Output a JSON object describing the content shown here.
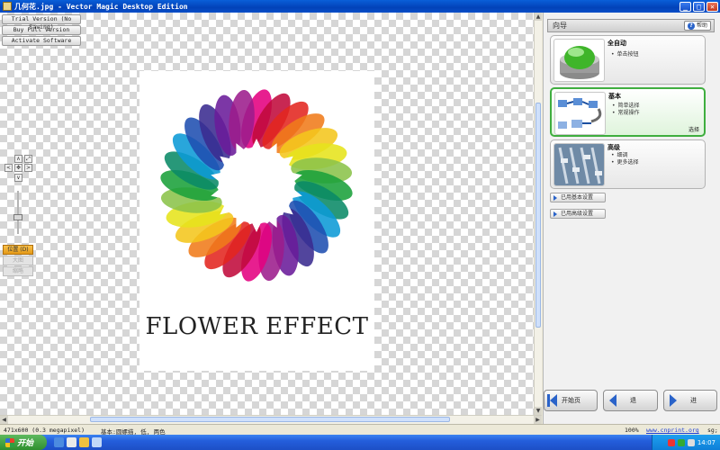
{
  "window": {
    "title": "几何花.jpg - Vector Magic Desktop Edition",
    "buttons": [
      "_",
      "□",
      "✕"
    ]
  },
  "trial": {
    "buttons": [
      "Trial Version (No Saving)",
      "Buy Full Version",
      "Activate Software"
    ]
  },
  "nav_tools": {
    "up": "∧",
    "down": "∨",
    "left": "<",
    "right": ">",
    "fit": "✥",
    "expand": "⤢"
  },
  "view_panel": {
    "buttons": [
      {
        "label": "位置 (D)",
        "state": "active"
      },
      {
        "label": "大图",
        "state": "disabled"
      },
      {
        "label": "缩略",
        "state": "disabled"
      }
    ]
  },
  "image": {
    "caption": "FLOWER EFFECT"
  },
  "wizard": {
    "header": "向导",
    "help_label": "帮助",
    "cards": [
      {
        "title": "全自动",
        "bullets": [
          "单击按钮"
        ],
        "note": "",
        "selected": false
      },
      {
        "title": "基本",
        "bullets": [
          "简单选择",
          "常规操作"
        ],
        "note": "选择",
        "selected": true
      },
      {
        "title": "高级",
        "bullets": [
          "细调",
          "更多选择"
        ],
        "note": "",
        "selected": false
      }
    ],
    "links": [
      "已用基本设置",
      "已用高级设置"
    ]
  },
  "bottom_nav": {
    "start": "开始页",
    "back": "退",
    "next": "进"
  },
  "statusbar": {
    "image_info": "471x600 (0.3 megapixel)",
    "mode": "基本:圆螺描, 低, 两色",
    "zoom": "100%",
    "website": "www.cnprint.org",
    "corner": "sg;"
  },
  "taskbar": {
    "start_label": "开始",
    "time": "14:07"
  },
  "colors": {
    "titlebar": "#0242b8",
    "selected_card_border": "#3fae3f",
    "accent_blue": "#2a63c9",
    "view_active": "#e59a17"
  },
  "icons": {
    "app": "vector-magic-icon",
    "help": "question-icon",
    "start_page": "home-arrow-icon",
    "back": "left-arrow-icon",
    "next": "right-arrow-icon"
  }
}
